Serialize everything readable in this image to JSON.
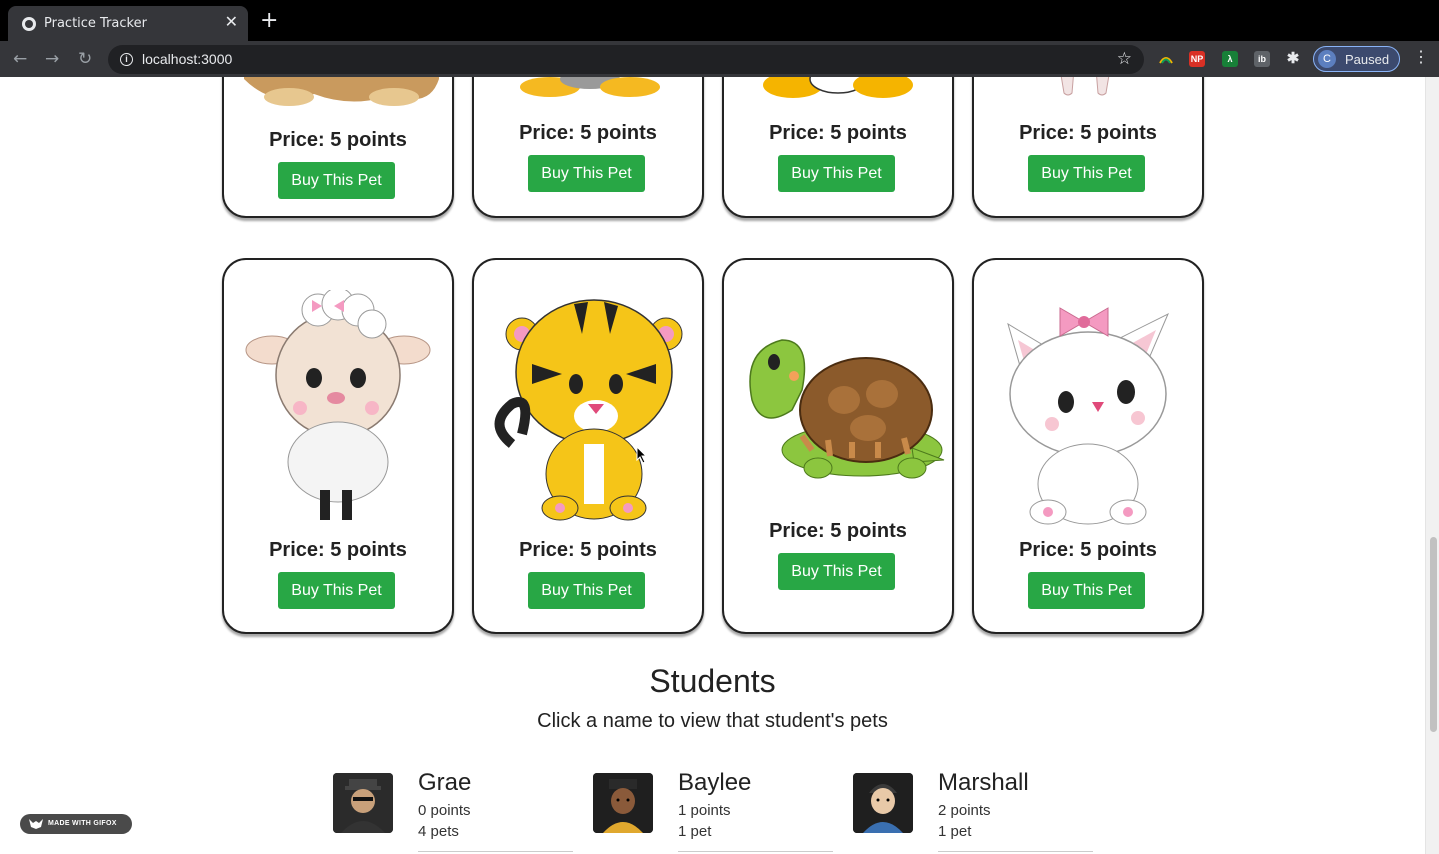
{
  "browser": {
    "tab_title": "Practice Tracker",
    "tab_close": "✕",
    "new_tab": "+",
    "url": "localhost:3000",
    "profile_initial": "C",
    "profile_status": "Paused",
    "extensions": [
      "NP",
      "λ",
      "ib"
    ]
  },
  "pets_top_row": [
    {
      "price": "Price: 5 points",
      "button": "Buy This Pet"
    },
    {
      "price": "Price: 5 points",
      "button": "Buy This Pet"
    },
    {
      "price": "Price: 5 points",
      "button": "Buy This Pet"
    },
    {
      "price": "Price: 5 points",
      "button": "Buy This Pet"
    }
  ],
  "pets_bottom_row": [
    {
      "animal": "lamb",
      "price": "Price: 5 points",
      "button": "Buy This Pet"
    },
    {
      "animal": "tiger",
      "price": "Price: 5 points",
      "button": "Buy This Pet"
    },
    {
      "animal": "turtle",
      "price": "Price: 5 points",
      "button": "Buy This Pet"
    },
    {
      "animal": "kitten",
      "price": "Price: 5 points",
      "button": "Buy This Pet"
    }
  ],
  "students_section": {
    "title": "Students",
    "subtitle": "Click a name to view that student's pets",
    "students": [
      {
        "name": "Grae",
        "points": "0 points",
        "pets": "4 pets"
      },
      {
        "name": "Baylee",
        "points": "1 points",
        "pets": "1 pet"
      },
      {
        "name": "Marshall",
        "points": "2 points",
        "pets": "1 pet"
      }
    ]
  },
  "colors": {
    "buy_button": "#28a745",
    "browser_dark": "#35363a"
  },
  "watermark": "MADE WITH GIFOX"
}
